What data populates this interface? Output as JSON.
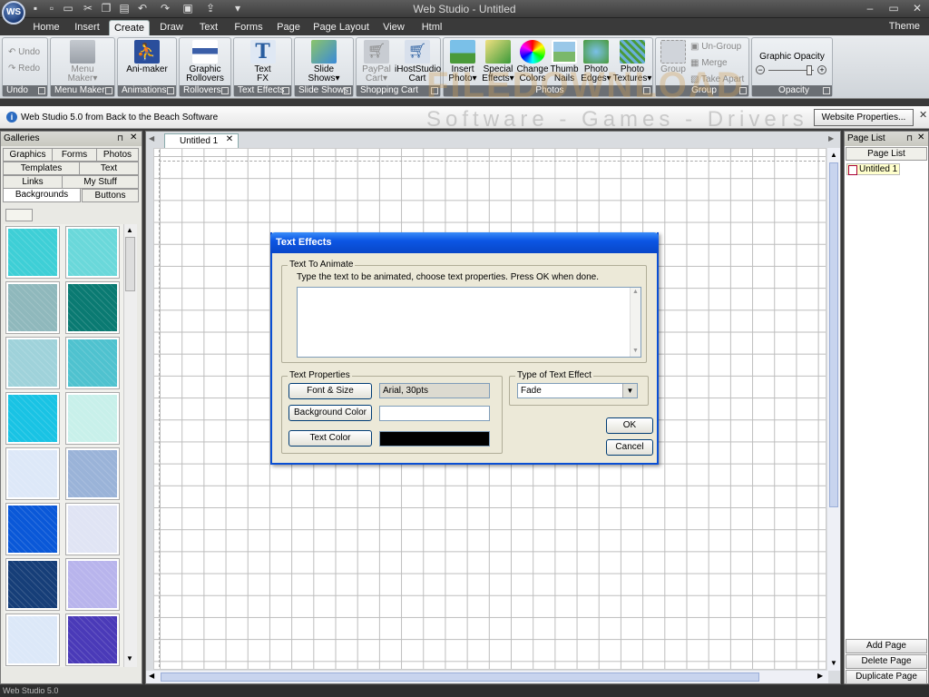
{
  "app": {
    "title": "Web Studio - Untitled",
    "logo_text": "WS",
    "theme_label": "Theme",
    "status": "Web Studio 5.0"
  },
  "ribbon_tabs": [
    "Home",
    "Insert",
    "Create",
    "Draw",
    "Text",
    "Forms",
    "Page",
    "Page Layout",
    "View",
    "Html"
  ],
  "active_tab": "Create",
  "ribbon": {
    "undo": "Undo",
    "redo": "Redo",
    "menu_maker_1": "Menu",
    "menu_maker_2": "Maker",
    "animaker": "Ani-maker",
    "graphic_1": "Graphic",
    "graphic_2": "Rollovers",
    "text_1": "Text",
    "text_2": "FX",
    "slide_1": "Slide",
    "slide_2": "Shows",
    "paypal_1": "PayPal",
    "paypal_2": "Cart",
    "ihost_1": "iHostStudio",
    "ihost_2": "Cart",
    "insert_1": "Insert",
    "insert_2": "Photo",
    "special_1": "Special",
    "special_2": "Effects",
    "change_1": "Change",
    "change_2": "Colors",
    "thumb_1": "Thumb",
    "thumb_2": "Nails",
    "edges_1": "Photo",
    "edges_2": "Edges",
    "textures_1": "Photo",
    "textures_2": "Textures",
    "group": "Group",
    "ungroup": "Un-Group",
    "merge": "Merge",
    "take_apart": "Take Apart",
    "opacity_title": "Graphic Opacity",
    "groups": {
      "undo": "Undo",
      "menu": "Menu Maker",
      "anim": "Animations",
      "roll": "Rollovers",
      "tfx": "Text Effects",
      "slides": "Slide Shows",
      "cart": "Shopping Cart",
      "photos": "Photos",
      "group": "Group",
      "opacity": "Opacity"
    }
  },
  "watermark": {
    "line1": "FILEDOWNLOAD",
    "line2": "Software - Games - Drivers"
  },
  "infobar": {
    "text": "Web Studio 5.0 from Back to the Beach Software",
    "button": "Website Properties..."
  },
  "galleries": {
    "title": "Galleries",
    "tabs_row1": [
      "Graphics",
      "Forms",
      "Photos"
    ],
    "tabs_row2": [
      "Templates",
      "Text"
    ],
    "tabs_row3": [
      "Links",
      "My Stuff"
    ],
    "tabs_row4": [
      "Backgrounds",
      "Buttons"
    ],
    "thumb_colors": [
      "#3ecfd6",
      "#6ad8da",
      "#8fb8bc",
      "#0a7a72",
      "#9fd2da",
      "#4fc2cf",
      "#19c3e4",
      "#c8f0ea",
      "#dde8f8",
      "#9ab3d8",
      "#0a58d8",
      "#e0e4f4",
      "#163e78",
      "#b8b4ec",
      "#dce8f8",
      "#4a3ab8"
    ]
  },
  "document": {
    "tab_label": "Untitled 1"
  },
  "pagelist": {
    "title": "Page List",
    "tab": "Page List",
    "page": "Untitled 1",
    "add": "Add Page",
    "delete": "Delete Page",
    "duplicate": "Duplicate Page"
  },
  "dialog": {
    "title": "Text Effects",
    "animate_group": "Text To Animate",
    "instructions": "Type the text to be animated, choose text properties.  Press OK when done.",
    "props_group": "Text Properties",
    "font_button": "Font & Size",
    "font_value": "Arial, 30pts",
    "bg_button": "Background Color",
    "text_color_button": "Text Color",
    "bg_color": "#ffffff",
    "text_color": "#000000",
    "effect_group": "Type of Text Effect",
    "effect_value": "Fade",
    "ok": "OK",
    "cancel": "Cancel"
  }
}
